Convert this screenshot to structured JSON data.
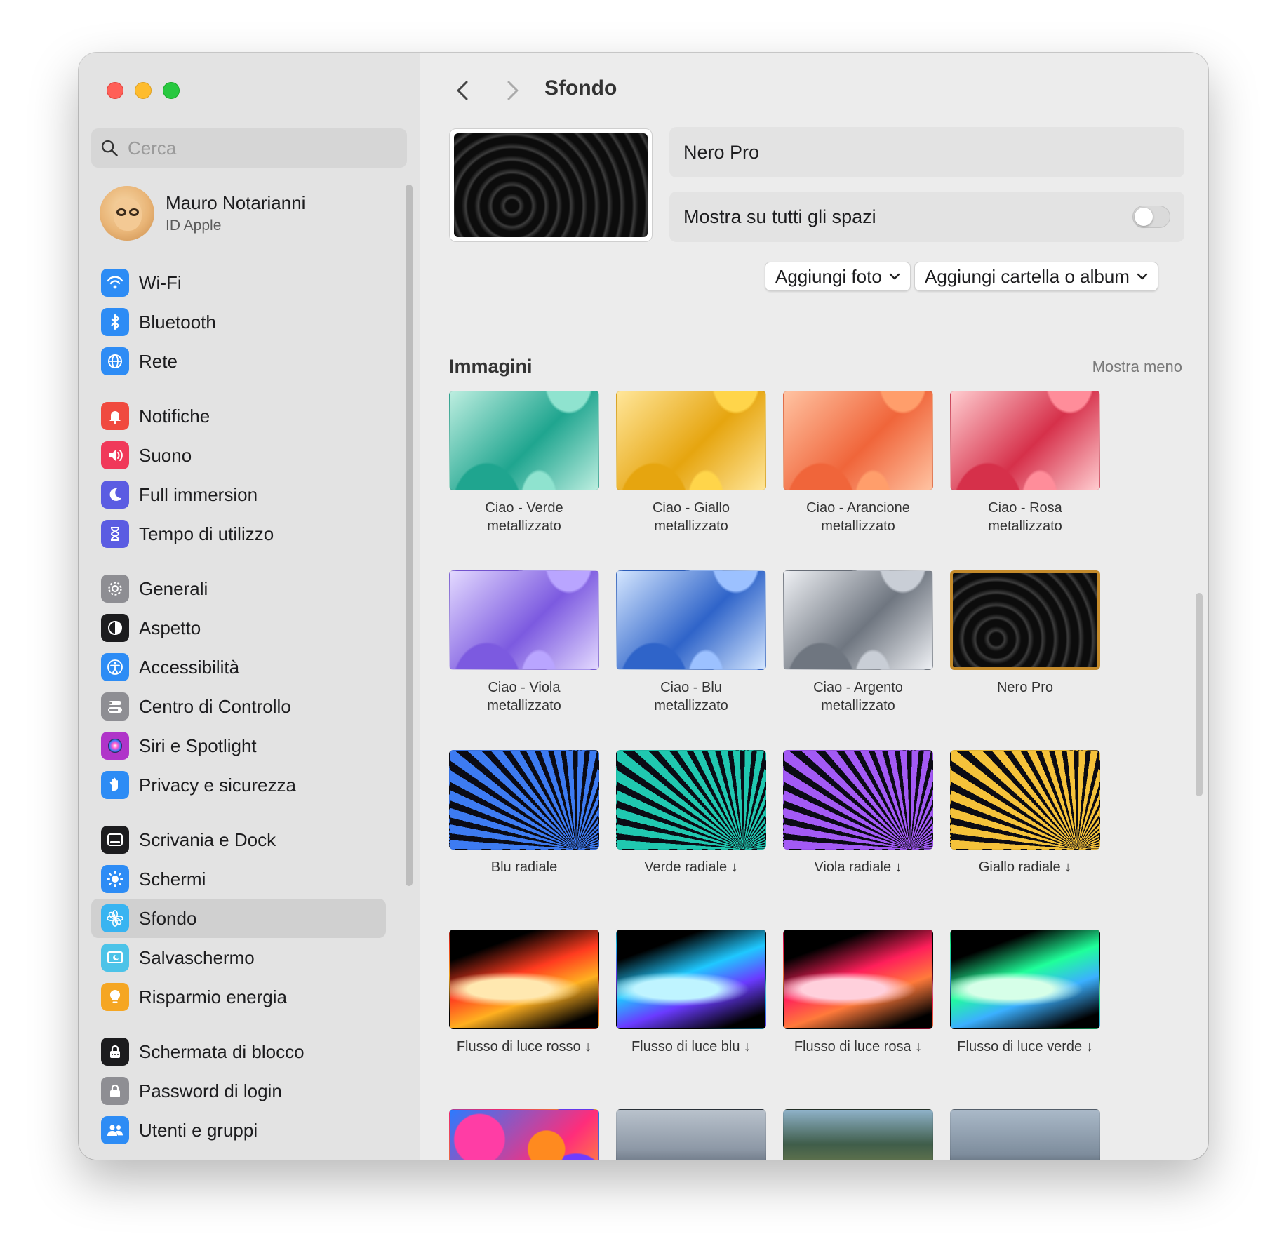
{
  "sidebar": {
    "search_placeholder": "Cerca",
    "profile": {
      "name": "Mauro Notarianni",
      "subtitle": "ID Apple"
    },
    "groups": [
      [
        {
          "label": "Wi-Fi",
          "icon": "wifi-icon",
          "color": "#2d8cf5"
        },
        {
          "label": "Bluetooth",
          "icon": "bluetooth-icon",
          "color": "#2d8cf5"
        },
        {
          "label": "Rete",
          "icon": "globe-icon",
          "color": "#2d8cf5"
        }
      ],
      [
        {
          "label": "Notifiche",
          "icon": "bell-icon",
          "color": "#f04a3f"
        },
        {
          "label": "Suono",
          "icon": "speaker-icon",
          "color": "#f0395a"
        },
        {
          "label": "Full immersion",
          "icon": "moon-icon",
          "color": "#5b5ce2"
        },
        {
          "label": "Tempo di utilizzo",
          "icon": "hourglass-icon",
          "color": "#5b5ce2"
        }
      ],
      [
        {
          "label": "Generali",
          "icon": "gear-icon",
          "color": "#8e8e93"
        },
        {
          "label": "Aspetto",
          "icon": "appearance-icon",
          "color": "#1c1c1e"
        },
        {
          "label": "Accessibilità",
          "icon": "accessibility-icon",
          "color": "#2d8cf5"
        },
        {
          "label": "Centro di Controllo",
          "icon": "control-center-icon",
          "color": "#8e8e93"
        },
        {
          "label": "Siri e Spotlight",
          "icon": "siri-icon",
          "color": "#b034c9"
        },
        {
          "label": "Privacy e sicurezza",
          "icon": "hand-icon",
          "color": "#2d8cf5"
        }
      ],
      [
        {
          "label": "Scrivania e Dock",
          "icon": "dock-icon",
          "color": "#1c1c1e"
        },
        {
          "label": "Schermi",
          "icon": "brightness-icon",
          "color": "#2d8cf5"
        },
        {
          "label": "Sfondo",
          "icon": "flower-icon",
          "color": "#38b4f1",
          "selected": true
        },
        {
          "label": "Salvaschermo",
          "icon": "screensaver-icon",
          "color": "#4cc3e8"
        },
        {
          "label": "Risparmio energia",
          "icon": "bulb-icon",
          "color": "#f5a623"
        }
      ],
      [
        {
          "label": "Schermata di blocco",
          "icon": "lock-screen-icon",
          "color": "#1c1c1e"
        },
        {
          "label": "Password di login",
          "icon": "lock-icon",
          "color": "#8e8e93"
        },
        {
          "label": "Utenti e gruppi",
          "icon": "users-icon",
          "color": "#2d8cf5"
        }
      ]
    ]
  },
  "header": {
    "title": "Sfondo"
  },
  "current": {
    "name": "Nero Pro",
    "show_all_spaces_label": "Mostra su tutti gli spazi",
    "show_all_spaces_on": false
  },
  "buttons": {
    "add_photo": "Aggiungi foto",
    "add_folder": "Aggiungi cartella o album"
  },
  "gallery": {
    "title": "Immagini",
    "toggle_label": "Mostra meno",
    "rows": [
      [
        {
          "caption": "Ciao - Verde\nmetallizzato",
          "style": "ciao-green"
        },
        {
          "caption": "Ciao - Giallo\nmetallizzato",
          "style": "ciao-yellow"
        },
        {
          "caption": "Ciao - Arancione\nmetallizzato",
          "style": "ciao-orange"
        },
        {
          "caption": "Ciao - Rosa\nmetallizzato",
          "style": "ciao-pink"
        }
      ],
      [
        {
          "caption": "Ciao - Viola\nmetallizzato",
          "style": "ciao-purple"
        },
        {
          "caption": "Ciao - Blu\nmetallizzato",
          "style": "ciao-blue"
        },
        {
          "caption": "Ciao - Argento\nmetallizzato",
          "style": "ciao-silver"
        },
        {
          "caption": "Nero Pro",
          "style": "nero-pro",
          "selected": true
        }
      ],
      [
        {
          "caption": "Blu radiale",
          "style": "radial-blue"
        },
        {
          "caption": "Verde radiale ↓",
          "style": "radial-green"
        },
        {
          "caption": "Viola radiale ↓",
          "style": "radial-purple"
        },
        {
          "caption": "Giallo radiale ↓",
          "style": "radial-yellow"
        }
      ],
      [
        {
          "caption": "Flusso di luce rosso ↓",
          "style": "flow-red"
        },
        {
          "caption": "Flusso di luce blu ↓",
          "style": "flow-blue"
        },
        {
          "caption": "Flusso di luce rosa ↓",
          "style": "flow-pink"
        },
        {
          "caption": "Flusso di luce verde ↓",
          "style": "flow-green"
        }
      ],
      [
        {
          "caption": "",
          "style": "colorful-shapes"
        },
        {
          "caption": "",
          "style": "mountains-fog"
        },
        {
          "caption": "",
          "style": "coast-mountains"
        },
        {
          "caption": "",
          "style": "sea-rocks"
        }
      ]
    ]
  }
}
